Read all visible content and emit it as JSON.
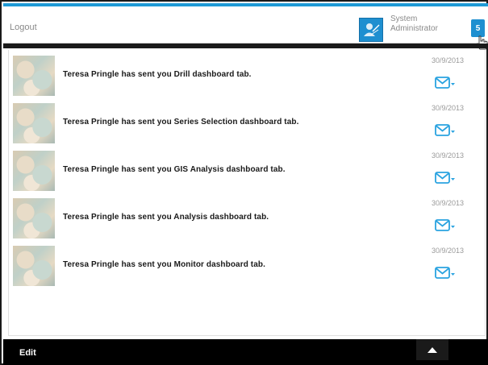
{
  "header": {
    "logout_label": "Logout",
    "user_name_line1": "System",
    "user_name_line2": "Administrator",
    "notification_count": "5"
  },
  "messages": [
    {
      "text": "Teresa Pringle has sent you Drill dashboard tab.",
      "date": "30/9/2013"
    },
    {
      "text": "Teresa Pringle has sent you Series Selection dashboard tab.",
      "date": "30/9/2013"
    },
    {
      "text": "Teresa Pringle has sent you GIS Analysis dashboard tab.",
      "date": "30/9/2013"
    },
    {
      "text": "Teresa Pringle has sent you Analysis dashboard tab.",
      "date": "30/9/2013"
    },
    {
      "text": "Teresa Pringle has sent you Monitor dashboard tab.",
      "date": "30/9/2013"
    }
  ],
  "footer": {
    "edit_label": "Edit"
  },
  "icons": {
    "avatar": "user-avatar-icon",
    "mail": "mail-icon",
    "dropdown": "chevron-down-icon",
    "scroll_up": "triangle-up-icon",
    "cursor": "hand-cursor-icon"
  },
  "colors": {
    "accent": "#1e9ad6",
    "badge": "#1e8fd0",
    "bar": "#000000"
  }
}
